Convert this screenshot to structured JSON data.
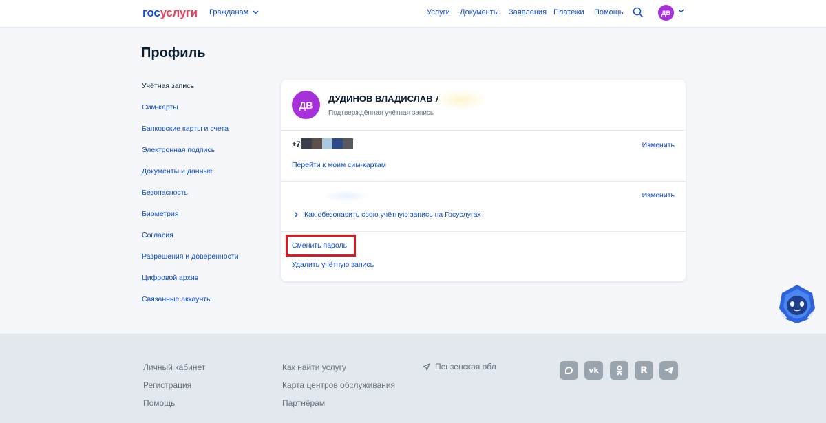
{
  "header": {
    "logo_part1": "гос",
    "logo_part2": "услуги",
    "audience": "Гражданам",
    "nav": [
      "Услуги",
      "Документы",
      "Заявления",
      "Платежи",
      "Помощь"
    ],
    "avatar_initials": "ДВ"
  },
  "page_title": "Профиль",
  "sidebar": {
    "items": [
      {
        "label": "Учётная запись",
        "active": true
      },
      {
        "label": "Сим-карты"
      },
      {
        "label": "Банковские карты и счета"
      },
      {
        "label": "Электронная подпись"
      },
      {
        "label": "Документы и данные"
      },
      {
        "label": "Безопасность"
      },
      {
        "label": "Биометрия"
      },
      {
        "label": "Согласия"
      },
      {
        "label": "Разрешения и доверенности"
      },
      {
        "label": "Цифровой архив"
      },
      {
        "label": "Связанные аккаунты"
      }
    ]
  },
  "account": {
    "avatar_initials": "ДВ",
    "name": "ДУДИНОВ ВЛАДИСЛАВ А",
    "status": "Подтверждённая учётная запись",
    "phone_prefix": "+7",
    "phone_change": "Изменить",
    "sim_link": "Перейти к моим сим-картам",
    "email_change": "Изменить",
    "security_link": "Как обезопасить свою учётную запись на Госуслугах",
    "change_password": "Сменить пароль",
    "delete_account": "Удалить учётную запись"
  },
  "colors": {
    "brand_blue": "#0d4cd3",
    "brand_red": "#ee3f58",
    "avatar": "#a630d9",
    "highlight": "#e0171f",
    "phone_mask": [
      "#3a3f4b",
      "#5e4f4a",
      "#a9c9dd",
      "#2f4a8a",
      "#58595e"
    ]
  },
  "footer": {
    "col1": [
      "Личный кабинет",
      "Регистрация",
      "Помощь"
    ],
    "col2": [
      "Как найти услугу",
      "Карта центров обслуживания",
      "Партнёрам"
    ],
    "region": "Пензенская обл",
    "socials": [
      "max-icon",
      "vk-icon",
      "ok-icon",
      "rutube-icon",
      "telegram-icon"
    ]
  }
}
